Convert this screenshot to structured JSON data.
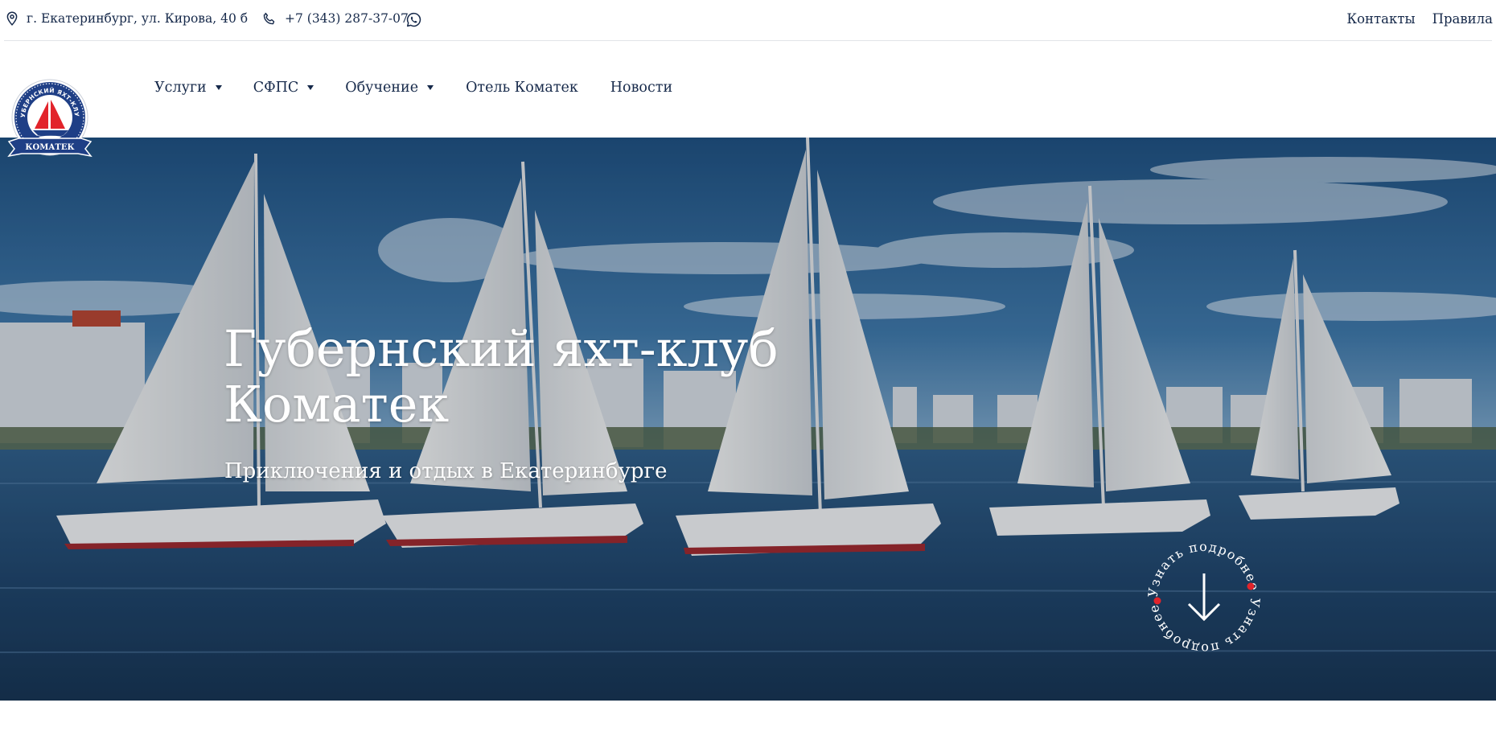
{
  "topbar": {
    "address": "г. Екатеринбург, ул. Кирова, 40 б",
    "phone": "+7 (343) 287-37-07",
    "links": [
      "Контакты",
      "Правила"
    ]
  },
  "logo": {
    "arc_text": "ГУБЕРНСКИЙ ЯХТ-КЛУБ",
    "ribbon_text": "КОМАТЕК"
  },
  "nav": {
    "items": [
      {
        "label": "Услуги",
        "dropdown": true
      },
      {
        "label": "СФПС",
        "dropdown": true
      },
      {
        "label": "Обучение",
        "dropdown": true
      },
      {
        "label": "Отель Коматек",
        "dropdown": false
      },
      {
        "label": "Новости",
        "dropdown": false
      }
    ]
  },
  "hero": {
    "title_line1": "Губернский яхт-клуб",
    "title_line2": "Коматек",
    "subtitle": "Приключения и отдых в Екатеринбурге",
    "more_label": "Узнать подробнее"
  },
  "colors": {
    "navy": "#16294a",
    "accent_red": "#e2242b",
    "white": "#ffffff"
  },
  "icons": [
    "location-pin-icon",
    "phone-icon",
    "whatsapp-icon",
    "caret-down-icon",
    "arrow-down-icon"
  ]
}
